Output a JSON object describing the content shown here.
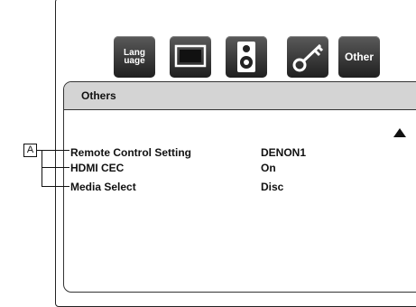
{
  "toolbar": {
    "language_label": "Lang\nuage",
    "other_label": "Other"
  },
  "panel": {
    "title": "Others",
    "rows": [
      {
        "label": "Remote Control Setting",
        "value": "DENON1"
      },
      {
        "label": "HDMI CEC",
        "value": "On"
      },
      {
        "label": "Media Select",
        "value": "Disc"
      }
    ]
  },
  "callout": {
    "letter": "A"
  },
  "icons": [
    "language-icon",
    "display-icon",
    "speaker-icon",
    "key-icon",
    "other-icon",
    "scroll-up-icon"
  ]
}
